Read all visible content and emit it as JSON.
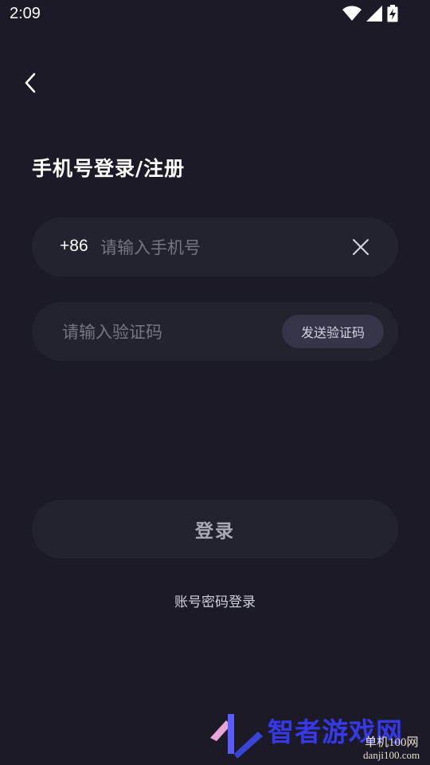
{
  "status_bar": {
    "time": "2:09",
    "icons": [
      "wifi-icon",
      "cellular-signal-icon",
      "battery-charging-icon"
    ]
  },
  "header": {
    "back_icon": "chevron-left-icon",
    "title": "手机号登录/注册"
  },
  "phone_field": {
    "country_code": "+86",
    "placeholder": "请输入手机号",
    "value": "",
    "clear_icon": "close-icon"
  },
  "code_field": {
    "placeholder": "请输入验证码",
    "value": "",
    "send_code_label": "发送验证码"
  },
  "actions": {
    "login_label": "登录",
    "password_login_label": "账号密码登录"
  },
  "watermark": {
    "main": "智者游戏网",
    "sub": "单机100网",
    "url": "danji100.com"
  },
  "colors": {
    "background": "#1b1a26",
    "field_background": "#23222f",
    "send_code_background": "#353449",
    "text_primary": "#ffffff",
    "placeholder": "#777583"
  }
}
